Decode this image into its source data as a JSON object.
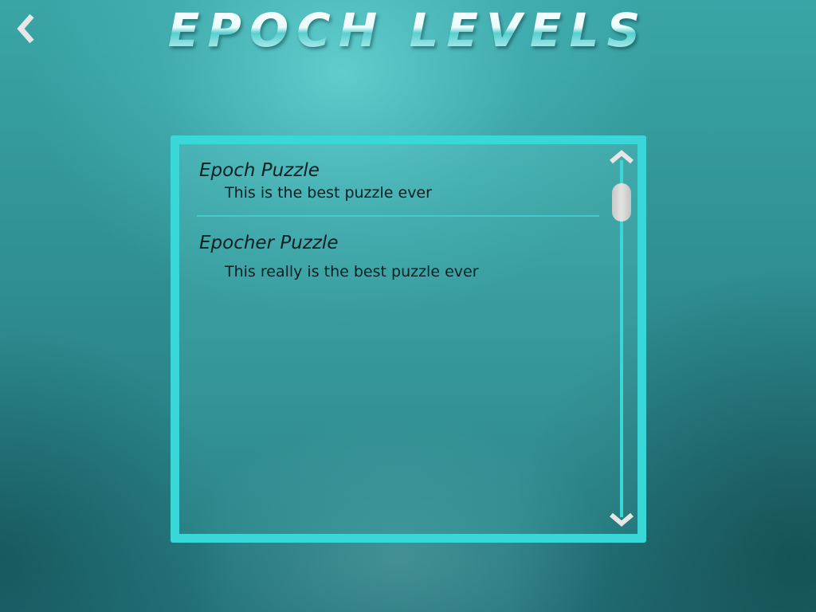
{
  "header": {
    "title": "Epoch Levels",
    "back_icon": "chevron-left-icon"
  },
  "levels": [
    {
      "name": "Epoch Puzzle",
      "description": "This is the best puzzle ever"
    },
    {
      "name": "Epocher Puzzle",
      "description": "This really is the best puzzle ever"
    }
  ],
  "scrollbar": {
    "up_icon": "chevron-up-icon",
    "down_icon": "chevron-down-icon"
  },
  "colors": {
    "accent": "#3ad7d8",
    "text": "#0c1f22",
    "thumb": "#d4d4d4"
  }
}
